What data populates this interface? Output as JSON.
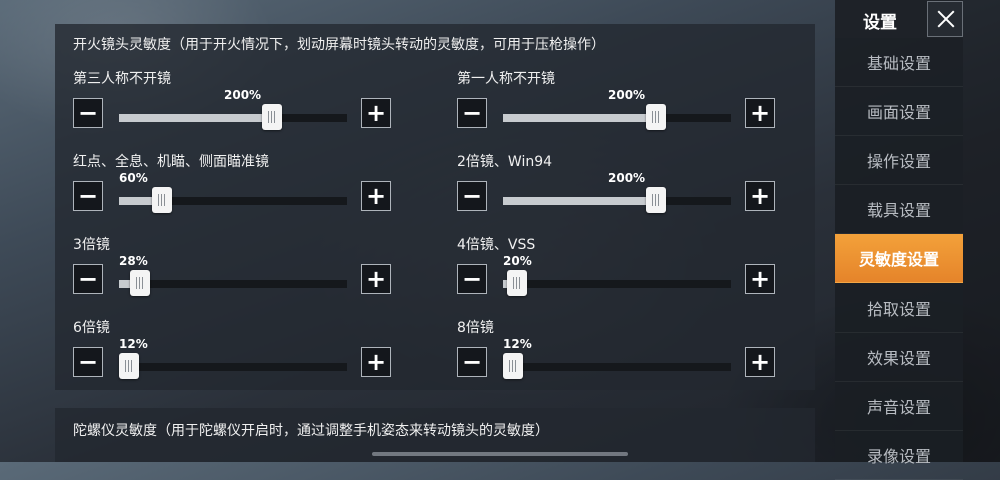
{
  "main": {
    "scope_section_title": "开火镜头灵敏度（用于开火情况下，划动屏幕时镜头转动的灵敏度，可用于压枪操作）",
    "gyro_section_title": "陀螺仪灵敏度（用于陀螺仪开启时，通过调整手机姿态来转动镜头的灵敏度）",
    "minus_label": "−",
    "plus_label": "+",
    "sliders": [
      {
        "label": "第三人称不开镜",
        "value_text": "200%",
        "fraction": 0.67
      },
      {
        "label": "第一人称不开镜",
        "value_text": "200%",
        "fraction": 0.67
      },
      {
        "label": "红点、全息、机瞄、侧面瞄准镜",
        "value_text": "60%",
        "fraction": 0.19
      },
      {
        "label": "2倍镜、Win94",
        "value_text": "200%",
        "fraction": 0.67
      },
      {
        "label": "3倍镜",
        "value_text": "28%",
        "fraction": 0.09
      },
      {
        "label": "4倍镜、VSS",
        "value_text": "20%",
        "fraction": 0.06
      },
      {
        "label": "6倍镜",
        "value_text": "12%",
        "fraction": 0.03
      },
      {
        "label": "8倍镜",
        "value_text": "12%",
        "fraction": 0.03
      }
    ]
  },
  "sidebar": {
    "title": "设置",
    "items": [
      {
        "label": "基础设置",
        "active": false
      },
      {
        "label": "画面设置",
        "active": false
      },
      {
        "label": "操作设置",
        "active": false
      },
      {
        "label": "载具设置",
        "active": false
      },
      {
        "label": "灵敏度设置",
        "active": true
      },
      {
        "label": "拾取设置",
        "active": false
      },
      {
        "label": "效果设置",
        "active": false
      },
      {
        "label": "声音设置",
        "active": false
      },
      {
        "label": "录像设置",
        "active": false
      }
    ]
  },
  "colors": {
    "accent": "#e8892c",
    "panel": "#23282f",
    "slider_fill": "#c7cbcf"
  }
}
